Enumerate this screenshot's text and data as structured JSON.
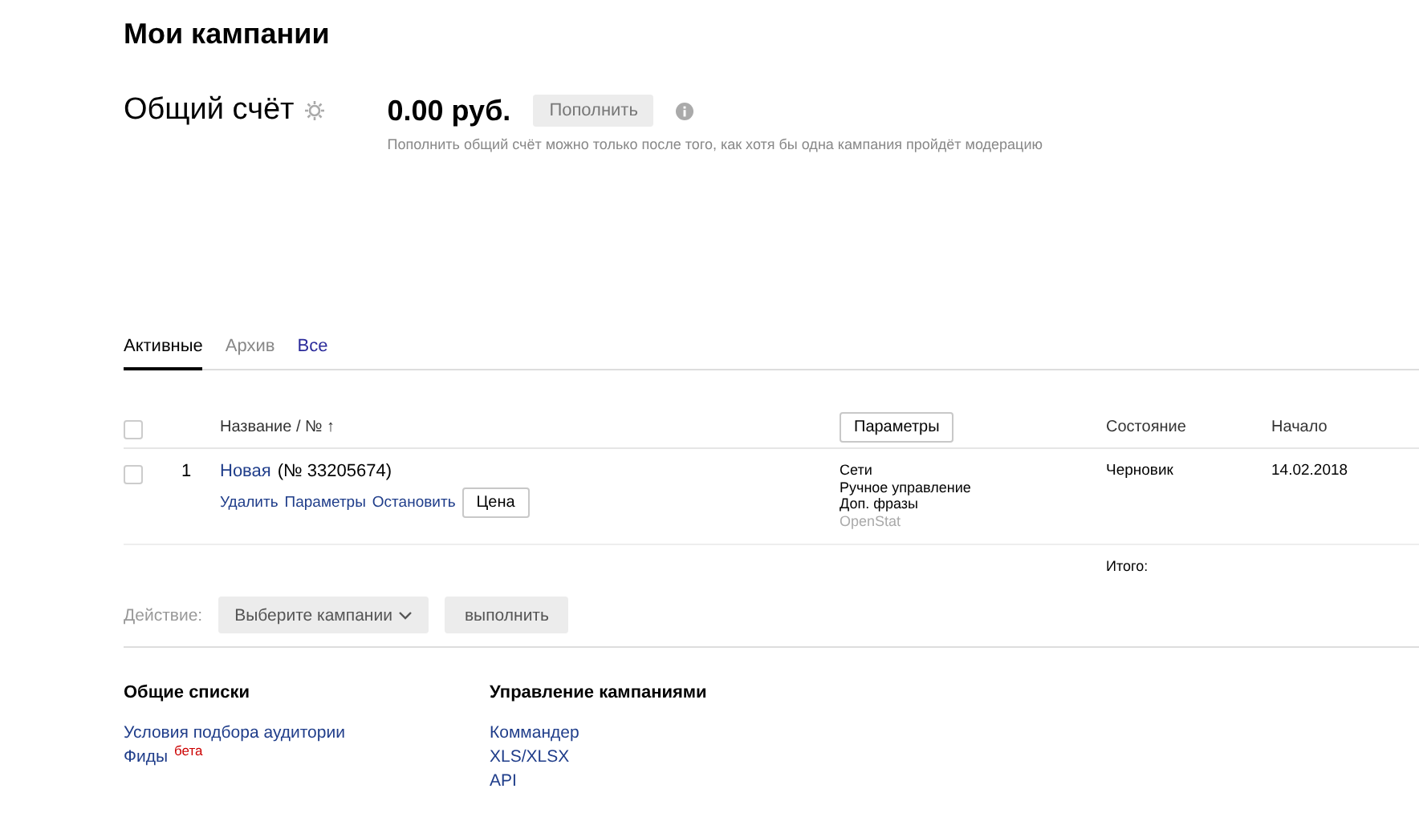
{
  "page_title": "Мои кампании",
  "account": {
    "label": "Общий счёт",
    "amount": "0.00 руб.",
    "topup_button": {
      "label": "Пополнить",
      "disabled": true
    },
    "hint": "Пополнить общий счёт можно только после того, как хотя бы одна кампания пройдёт модерацию"
  },
  "tabs": [
    {
      "label": "Активные",
      "selected": true,
      "disabled": false
    },
    {
      "label": "Архив",
      "selected": false,
      "disabled": true
    },
    {
      "label": "Все",
      "selected": false,
      "disabled": false
    }
  ],
  "table": {
    "select_all_checked": false,
    "name_header": "Название / № ↑",
    "params_button": "Параметры",
    "state_header": "Состояние",
    "start_header": "Начало",
    "rows": [
      {
        "checked": false,
        "number": "1",
        "name": "Новая",
        "id": "(№ 33205674)",
        "actions": [
          "Удалить",
          "Параметры",
          "Остановить"
        ],
        "price_button": "Цена",
        "params": [
          {
            "text": "Сети",
            "disabled": false
          },
          {
            "text": "Ручное управление",
            "disabled": false
          },
          {
            "text": "Доп. фразы",
            "disabled": false
          },
          {
            "text": "OpenStat",
            "disabled": true
          }
        ],
        "state": "Черновик",
        "start": "14.02.2018"
      }
    ],
    "total_label": "Итого:"
  },
  "action_bar": {
    "label": "Действие:",
    "select": "Выберите кампании",
    "run_button": "выполнить"
  },
  "lists": [
    {
      "title": "Общие списки",
      "links": [
        {
          "text": "Условия подбора аудитории"
        },
        {
          "text": "Фиды",
          "badge": "бета"
        }
      ]
    },
    {
      "title": "Управление кампаниями",
      "links": [
        {
          "text": "Коммандер"
        },
        {
          "text": "XLS/XLSX"
        },
        {
          "text": "API"
        }
      ]
    }
  ]
}
